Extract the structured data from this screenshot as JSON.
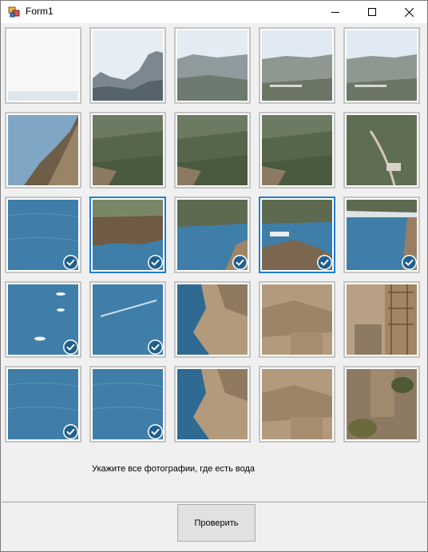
{
  "window": {
    "title": "Form1",
    "controls": {
      "minimize": "minimize",
      "maximize": "maximize",
      "close": "close"
    }
  },
  "captcha": {
    "instruction": "Укажите все фотографии, где есть вода",
    "rows": 5,
    "cols": 5,
    "tiles": [
      {
        "row": 1,
        "col": 1,
        "checked": false,
        "focused": false,
        "scene": "haze sky"
      },
      {
        "row": 1,
        "col": 2,
        "checked": false,
        "focused": false,
        "scene": "sky over cliffs"
      },
      {
        "row": 1,
        "col": 3,
        "checked": false,
        "focused": false,
        "scene": "sky over ridge"
      },
      {
        "row": 1,
        "col": 4,
        "checked": false,
        "focused": false,
        "scene": "sky over hills"
      },
      {
        "row": 1,
        "col": 5,
        "checked": false,
        "focused": false,
        "scene": "sky over hills"
      },
      {
        "row": 2,
        "col": 1,
        "checked": false,
        "focused": false,
        "scene": "sea and cliff"
      },
      {
        "row": 2,
        "col": 2,
        "checked": false,
        "focused": false,
        "scene": "green slope"
      },
      {
        "row": 2,
        "col": 3,
        "checked": false,
        "focused": false,
        "scene": "green slope"
      },
      {
        "row": 2,
        "col": 4,
        "checked": false,
        "focused": false,
        "scene": "green slope"
      },
      {
        "row": 2,
        "col": 5,
        "checked": false,
        "focused": false,
        "scene": "hill with road"
      },
      {
        "row": 3,
        "col": 1,
        "checked": true,
        "focused": false,
        "scene": "water"
      },
      {
        "row": 3,
        "col": 2,
        "checked": true,
        "focused": true,
        "scene": "water and cliff"
      },
      {
        "row": 3,
        "col": 3,
        "checked": true,
        "focused": false,
        "scene": "water and shore"
      },
      {
        "row": 3,
        "col": 4,
        "checked": true,
        "focused": true,
        "scene": "harbor"
      },
      {
        "row": 3,
        "col": 5,
        "checked": true,
        "focused": false,
        "scene": "bay"
      },
      {
        "row": 4,
        "col": 1,
        "checked": true,
        "focused": false,
        "scene": "water with boats"
      },
      {
        "row": 4,
        "col": 2,
        "checked": true,
        "focused": false,
        "scene": "water with wake"
      },
      {
        "row": 4,
        "col": 3,
        "checked": false,
        "focused": false,
        "scene": "rocky shore"
      },
      {
        "row": 4,
        "col": 4,
        "checked": false,
        "focused": false,
        "scene": "rocks"
      },
      {
        "row": 4,
        "col": 5,
        "checked": false,
        "focused": false,
        "scene": "fortress ruins"
      },
      {
        "row": 5,
        "col": 1,
        "checked": true,
        "focused": false,
        "scene": "water"
      },
      {
        "row": 5,
        "col": 2,
        "checked": true,
        "focused": false,
        "scene": "water"
      },
      {
        "row": 5,
        "col": 3,
        "checked": false,
        "focused": false,
        "scene": "rocky shore"
      },
      {
        "row": 5,
        "col": 4,
        "checked": false,
        "focused": false,
        "scene": "rocks"
      },
      {
        "row": 5,
        "col": 5,
        "checked": false,
        "focused": false,
        "scene": "ruins and shrubs"
      }
    ]
  },
  "footer": {
    "verify_label": "Проверить"
  },
  "colors": {
    "accent": "#1f7fd0",
    "check_bg": "#1e5f8e",
    "sky": "#dbe6f0",
    "sea": "#3e7ea8",
    "sea_dark": "#2e6a92",
    "cliff": "#8c7a62",
    "rock": "#b29a7c",
    "green": "#5c6a44"
  }
}
